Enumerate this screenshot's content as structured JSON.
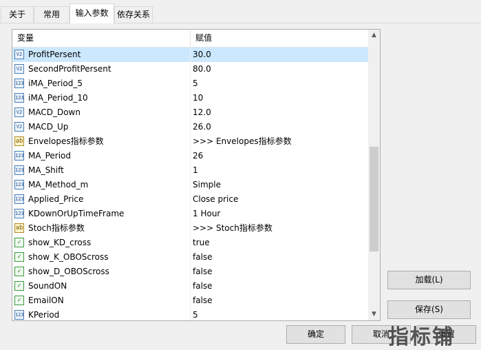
{
  "tabs": [
    {
      "label": "关于"
    },
    {
      "label": "常用"
    },
    {
      "label": "输入参数"
    },
    {
      "label": "依存关系"
    }
  ],
  "table": {
    "col_name": "变量",
    "col_value": "赋值",
    "rows": [
      {
        "type": "double",
        "icon": "V2",
        "name": "ProfitPersent",
        "value": "30.0"
      },
      {
        "type": "double",
        "icon": "V2",
        "name": "SecondProfitPersent",
        "value": "80.0"
      },
      {
        "type": "int",
        "icon": "123",
        "name": "iMA_Period_5",
        "value": "5"
      },
      {
        "type": "int",
        "icon": "123",
        "name": "iMA_Period_10",
        "value": "10"
      },
      {
        "type": "double",
        "icon": "V2",
        "name": "MACD_Down",
        "value": "12.0"
      },
      {
        "type": "double",
        "icon": "V2",
        "name": "MACD_Up",
        "value": "26.0"
      },
      {
        "type": "string",
        "icon": "ab",
        "name": "Envelopes指标参数",
        "value": ">>> Envelopes指标参数"
      },
      {
        "type": "int",
        "icon": "123",
        "name": "MA_Period",
        "value": "26"
      },
      {
        "type": "int",
        "icon": "123",
        "name": "MA_Shift",
        "value": "1"
      },
      {
        "type": "int",
        "icon": "123",
        "name": "MA_Method_m",
        "value": "Simple"
      },
      {
        "type": "int",
        "icon": "123",
        "name": "Applied_Price",
        "value": "Close price"
      },
      {
        "type": "int",
        "icon": "123",
        "name": "KDownOrUpTimeFrame",
        "value": "1 Hour"
      },
      {
        "type": "string",
        "icon": "ab",
        "name": "Stoch指标参数",
        "value": ">>> Stoch指标参数"
      },
      {
        "type": "bool",
        "icon": "✓",
        "name": "show_KD_cross",
        "value": "true"
      },
      {
        "type": "bool",
        "icon": "✓",
        "name": "show_K_OBOScross",
        "value": "false"
      },
      {
        "type": "bool",
        "icon": "✓",
        "name": "show_D_OBOScross",
        "value": "false"
      },
      {
        "type": "bool",
        "icon": "✓",
        "name": "SoundON",
        "value": "false"
      },
      {
        "type": "bool",
        "icon": "✓",
        "name": "EmailON",
        "value": "false"
      },
      {
        "type": "int",
        "icon": "123",
        "name": "KPeriod",
        "value": "5"
      }
    ]
  },
  "buttons": {
    "load": "加载(L)",
    "save": "保存(S)",
    "ok": "确定",
    "cancel": "取消",
    "reset": "重置"
  },
  "watermark": "指标铺"
}
